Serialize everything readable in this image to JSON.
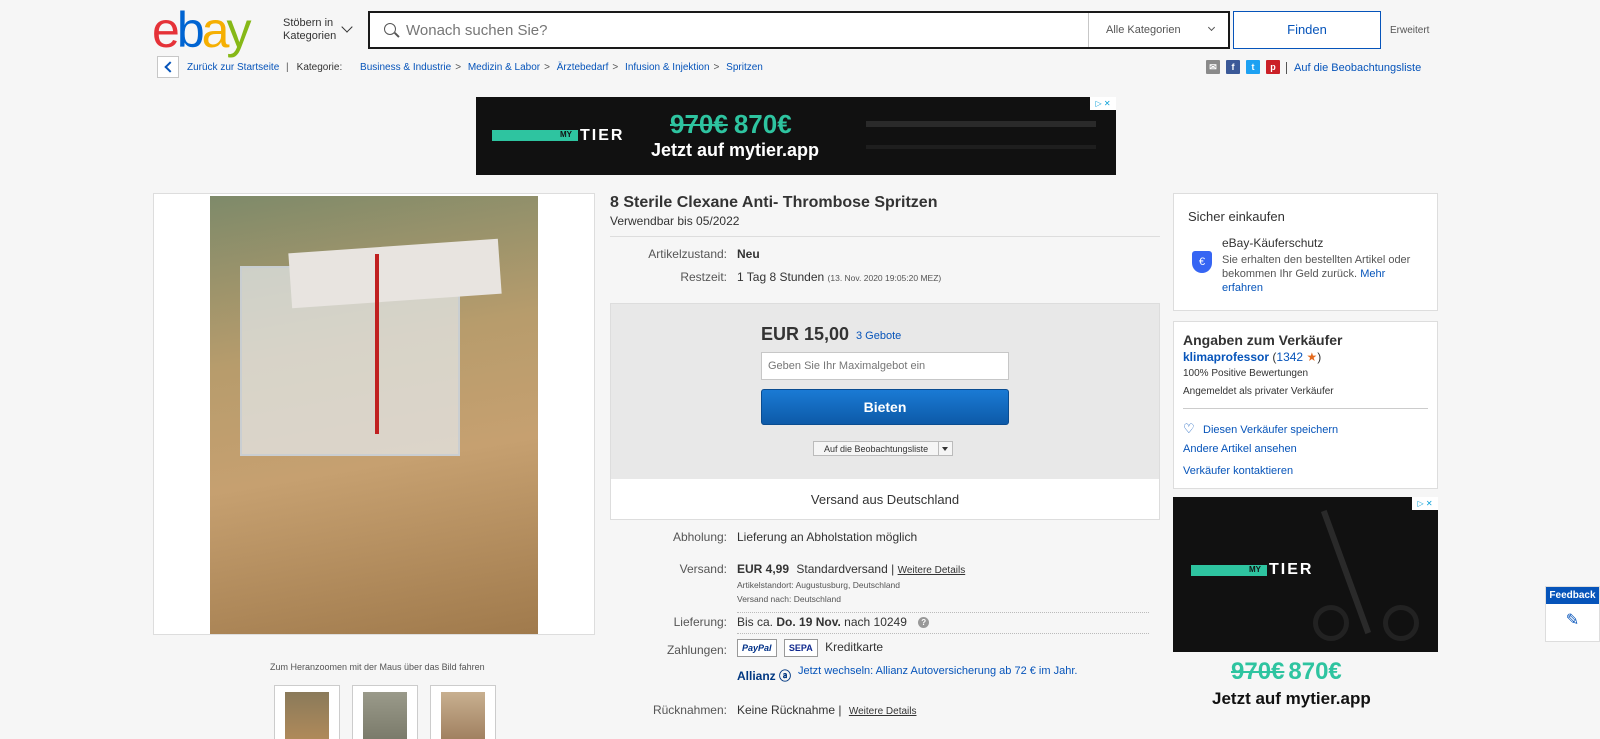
{
  "header": {
    "logo_letters": [
      "e",
      "b",
      "a",
      "y"
    ],
    "browse_label": "Stöbern in Kategorien",
    "search_placeholder": "Wonach suchen Sie?",
    "category_select": "Alle Kategorien",
    "find_button": "Finden",
    "advanced_link": "Erweitert"
  },
  "breadcrumb": {
    "back_label": "Zurück zur Startseite",
    "category_label": "Kategorie:",
    "items": [
      "Business & Industrie",
      "Medizin & Labor",
      "Ärztebedarf",
      "Infusion & Injektion",
      "Spritzen"
    ],
    "separator": ">",
    "watchlist_link": "Auf die Beobachtungsliste",
    "share_icons": [
      "mail-icon",
      "facebook-icon",
      "twitter-icon",
      "pinterest-icon"
    ]
  },
  "ad_top": {
    "stripe_label": "MY",
    "brand": "TIER",
    "old_price": "970€",
    "new_price": "870€",
    "cta": "Jetzt auf mytier.app",
    "badge": "▷ ✕"
  },
  "gallery": {
    "zoom_hint": "Zum Heranzoomen mit der Maus über das Bild fahren",
    "thumbnail_count": 3
  },
  "item": {
    "title": "8 Sterile Clexane Anti- Thrombose Spritzen",
    "subtitle": "Verwendbar bis 05/2022",
    "condition_label": "Artikelzustand:",
    "condition_value": "Neu",
    "time_label": "Restzeit:",
    "time_value": "1 Tag 8 Stunden",
    "time_detail": "(13. Nov. 2020   19:05:20 MEZ)"
  },
  "bid": {
    "price": "EUR 15,00",
    "bids_link": "3 Gebote",
    "max_placeholder": "Geben Sie Ihr Maximalgebot ein",
    "bid_button": "Bieten",
    "watch_button": "Auf die Beobachtungsliste",
    "shipping_from": "Versand aus Deutschland"
  },
  "details": {
    "pickup_label": "Abholung:",
    "pickup_value": "Lieferung an Abholstation möglich",
    "shipping_label": "Versand:",
    "shipping_price": "EUR 4,99",
    "shipping_method": "Standardversand |",
    "shipping_more": "Weitere Details",
    "location": "Artikelstandort:  Augustusburg, Deutschland",
    "ships_to": "Versand nach:  Deutschland",
    "delivery_label": "Lieferung:",
    "delivery_prefix": "Bis ca.",
    "delivery_date": "Do. 19 Nov.",
    "delivery_suffix": "nach 10249",
    "delivery_help": "?",
    "payments_label": "Zahlungen:",
    "payment_logos": [
      "PayPal",
      "SEPA"
    ],
    "payment_card": "Kreditkarte",
    "allianz_logo": "Allianz ⓐ",
    "allianz_text": "Jetzt wechseln: Allianz Autoversicherung ab 72 € im Jahr.",
    "returns_label": "Rücknahmen:",
    "returns_value": "Keine Rücknahme |",
    "returns_more": "Weitere Details"
  },
  "safe_shopping": {
    "title": "Sicher einkaufen",
    "shield": "€",
    "protection_title": "eBay-Käuferschutz",
    "protection_text": "Sie erhalten den bestellten Artikel oder bekommen Ihr Geld zurück.",
    "more_link": "Mehr erfahren"
  },
  "seller": {
    "title": "Angaben zum Verkäufer",
    "name": "klimaprofessor",
    "score": "1342",
    "star": "★",
    "positive": "100% Positive Bewertungen",
    "type": "Angemeldet als privater Verkäufer",
    "save_link": "Diesen Verkäufer speichern",
    "heart": "♡",
    "other_items": "Andere Artikel ansehen",
    "contact": "Verkäufer kontaktieren"
  },
  "ad_side": {
    "stripe_label": "MY",
    "brand": "TIER",
    "old_price": "970€",
    "new_price": "870€",
    "cta": "Jetzt auf mytier.app",
    "badge": "▷ ✕"
  },
  "feedback": {
    "label": "Feedback",
    "icon": "✎"
  }
}
